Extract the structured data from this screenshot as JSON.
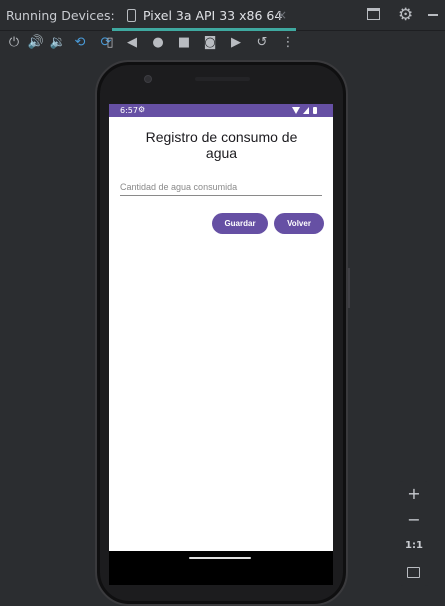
{
  "tool_window": {
    "title": "Running Devices:",
    "tab": {
      "label": "Pixel 3a API 33 x86 64",
      "close": "×"
    }
  },
  "toolbar": {
    "icons": [
      "power-icon",
      "volume-up-icon",
      "volume-down-icon",
      "rotate-left-icon",
      "rotate-right-icon",
      "fold-icon",
      "back-icon",
      "home-icon",
      "overview-icon",
      "screenshot-icon",
      "screen-record-icon",
      "snapshot-history-icon",
      "more-options-icon"
    ]
  },
  "android": {
    "status_bar": {
      "time": "6:57"
    },
    "app": {
      "title": "Registro de consumo de agua",
      "input_placeholder": "Cantidad de agua consumida",
      "save_label": "Guardar",
      "back_label": "Volver"
    }
  },
  "zoom_controls": {
    "zoom_in": "+",
    "zoom_out": "−",
    "actual_size": "1:1"
  },
  "colors": {
    "ide_background": "#2b2d30",
    "tab_accent": "#3fa9a0",
    "app_primary": "#6650a4",
    "status_bar": "#6650a4",
    "screen_background": "#ffffff"
  }
}
